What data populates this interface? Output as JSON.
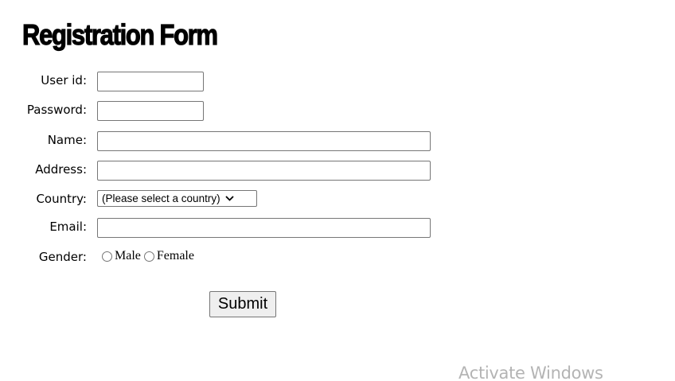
{
  "form": {
    "title": "Registration Form",
    "fields": {
      "user_id": {
        "label": "User id:",
        "value": ""
      },
      "password": {
        "label": "Password:",
        "value": ""
      },
      "name": {
        "label": "Name:",
        "value": ""
      },
      "address": {
        "label": "Address:",
        "value": ""
      },
      "country": {
        "label": "Country:",
        "selected": "(Please select a country)"
      },
      "email": {
        "label": "Email:",
        "value": ""
      },
      "gender": {
        "label": "Gender:",
        "options": [
          "Male",
          "Female"
        ]
      }
    },
    "submit_label": "Submit"
  },
  "watermark": {
    "text": "Activate Windows"
  }
}
